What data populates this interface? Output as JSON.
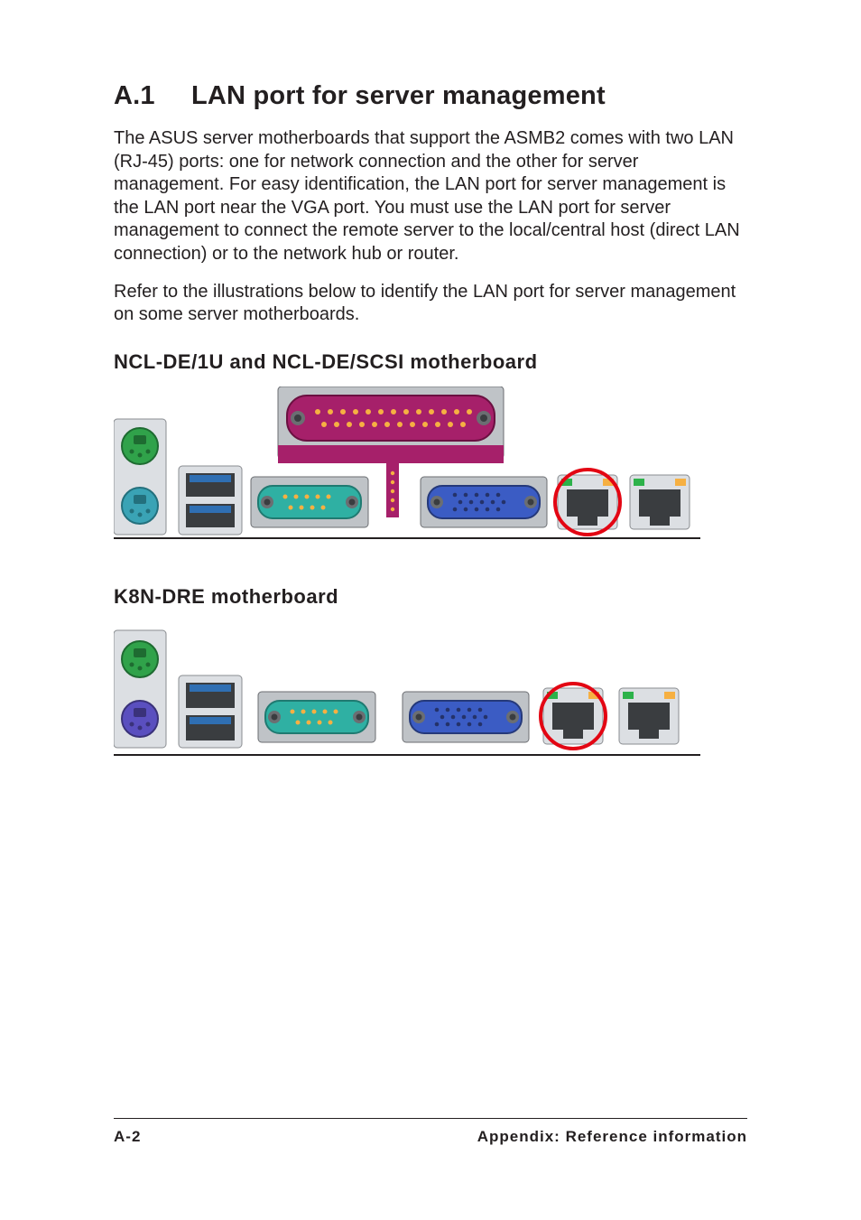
{
  "section": {
    "number": "A.1",
    "title": "LAN port for server management"
  },
  "paragraphs": {
    "p1": "The ASUS server motherboards that support the ASMB2 comes with two LAN (RJ-45) ports: one for network connection and the other for server management. For easy identification, the LAN port for server management is the LAN port near the VGA port. You must use the LAN port for server management to connect the remote server to the local/central host (direct LAN connection) or to the network hub or router.",
    "p2": "Refer to the illustrations below to identify the LAN port for server management on some server motherboards."
  },
  "subheadings": {
    "s1": "NCL-DE/1U and NCL-DE/SCSI motherboard",
    "s2": "K8N-DRE motherboard"
  },
  "footer": {
    "page": "A-2",
    "label": "Appendix: Reference information"
  }
}
